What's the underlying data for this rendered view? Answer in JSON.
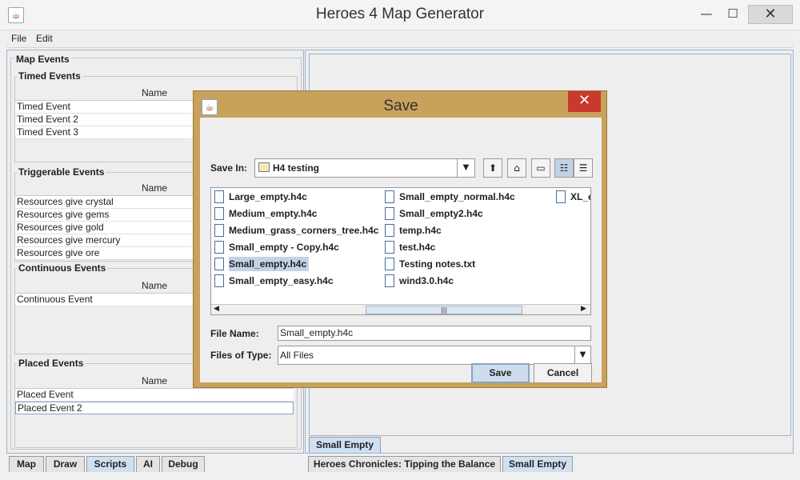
{
  "window": {
    "title": "Heroes 4 Map Generator",
    "min_icon": "minimize-icon",
    "max_icon": "maximize-icon",
    "close_icon": "close-icon"
  },
  "menu": {
    "file": "File",
    "edit": "Edit"
  },
  "events": {
    "title": "Map Events",
    "timed": {
      "title": "Timed Events",
      "header": "Name",
      "rows": [
        "Timed Event",
        "Timed Event 2",
        "Timed Event 3"
      ]
    },
    "triggerable": {
      "title": "Triggerable Events",
      "header": "Name",
      "rows": [
        "Resources give crystal",
        "Resources give gems",
        "Resources give gold",
        "Resources give mercury",
        "Resources give ore"
      ]
    },
    "continuous": {
      "title": "Continuous Events",
      "header": "Name",
      "rows": [
        "Continuous Event"
      ]
    },
    "placed": {
      "title": "Placed Events",
      "header": "Name",
      "rows": [
        "Placed Event",
        "Placed Event 2"
      ]
    }
  },
  "left_tabs": [
    "Map",
    "Draw",
    "Scripts",
    "AI",
    "Debug"
  ],
  "left_tab_selected": "Scripts",
  "right": {
    "inner_tab": "Small Empty",
    "bottom_tabs": [
      "Heroes Chronicles: Tipping the Balance",
      "Small Empty"
    ],
    "bottom_tab_selected": "Small Empty"
  },
  "dialog": {
    "title": "Save",
    "save_in_label": "Save In:",
    "save_in_value": "H4 testing",
    "toolbar_icons": [
      "up-one-level-icon",
      "home-icon",
      "new-folder-icon",
      "list-view-icon",
      "details-view-icon"
    ],
    "files_col1": [
      "Large_empty.h4c",
      "Medium_empty.h4c",
      "Medium_grass_corners_tree.h4c",
      "Small_empty - Copy.h4c",
      "Small_empty.h4c",
      "Small_empty_easy.h4c"
    ],
    "files_col2": [
      "Small_empty_normal.h4c",
      "Small_empty2.h4c",
      "temp.h4c",
      "test.h4c",
      "Testing notes.txt",
      "wind3.0.h4c"
    ],
    "files_col3": [
      "XL_e"
    ],
    "selected_file": "Small_empty.h4c",
    "file_name_label": "File Name:",
    "file_name_value": "Small_empty.h4c",
    "file_type_label": "Files of Type:",
    "file_type_value": "All Files",
    "save_button": "Save",
    "cancel_button": "Cancel"
  }
}
